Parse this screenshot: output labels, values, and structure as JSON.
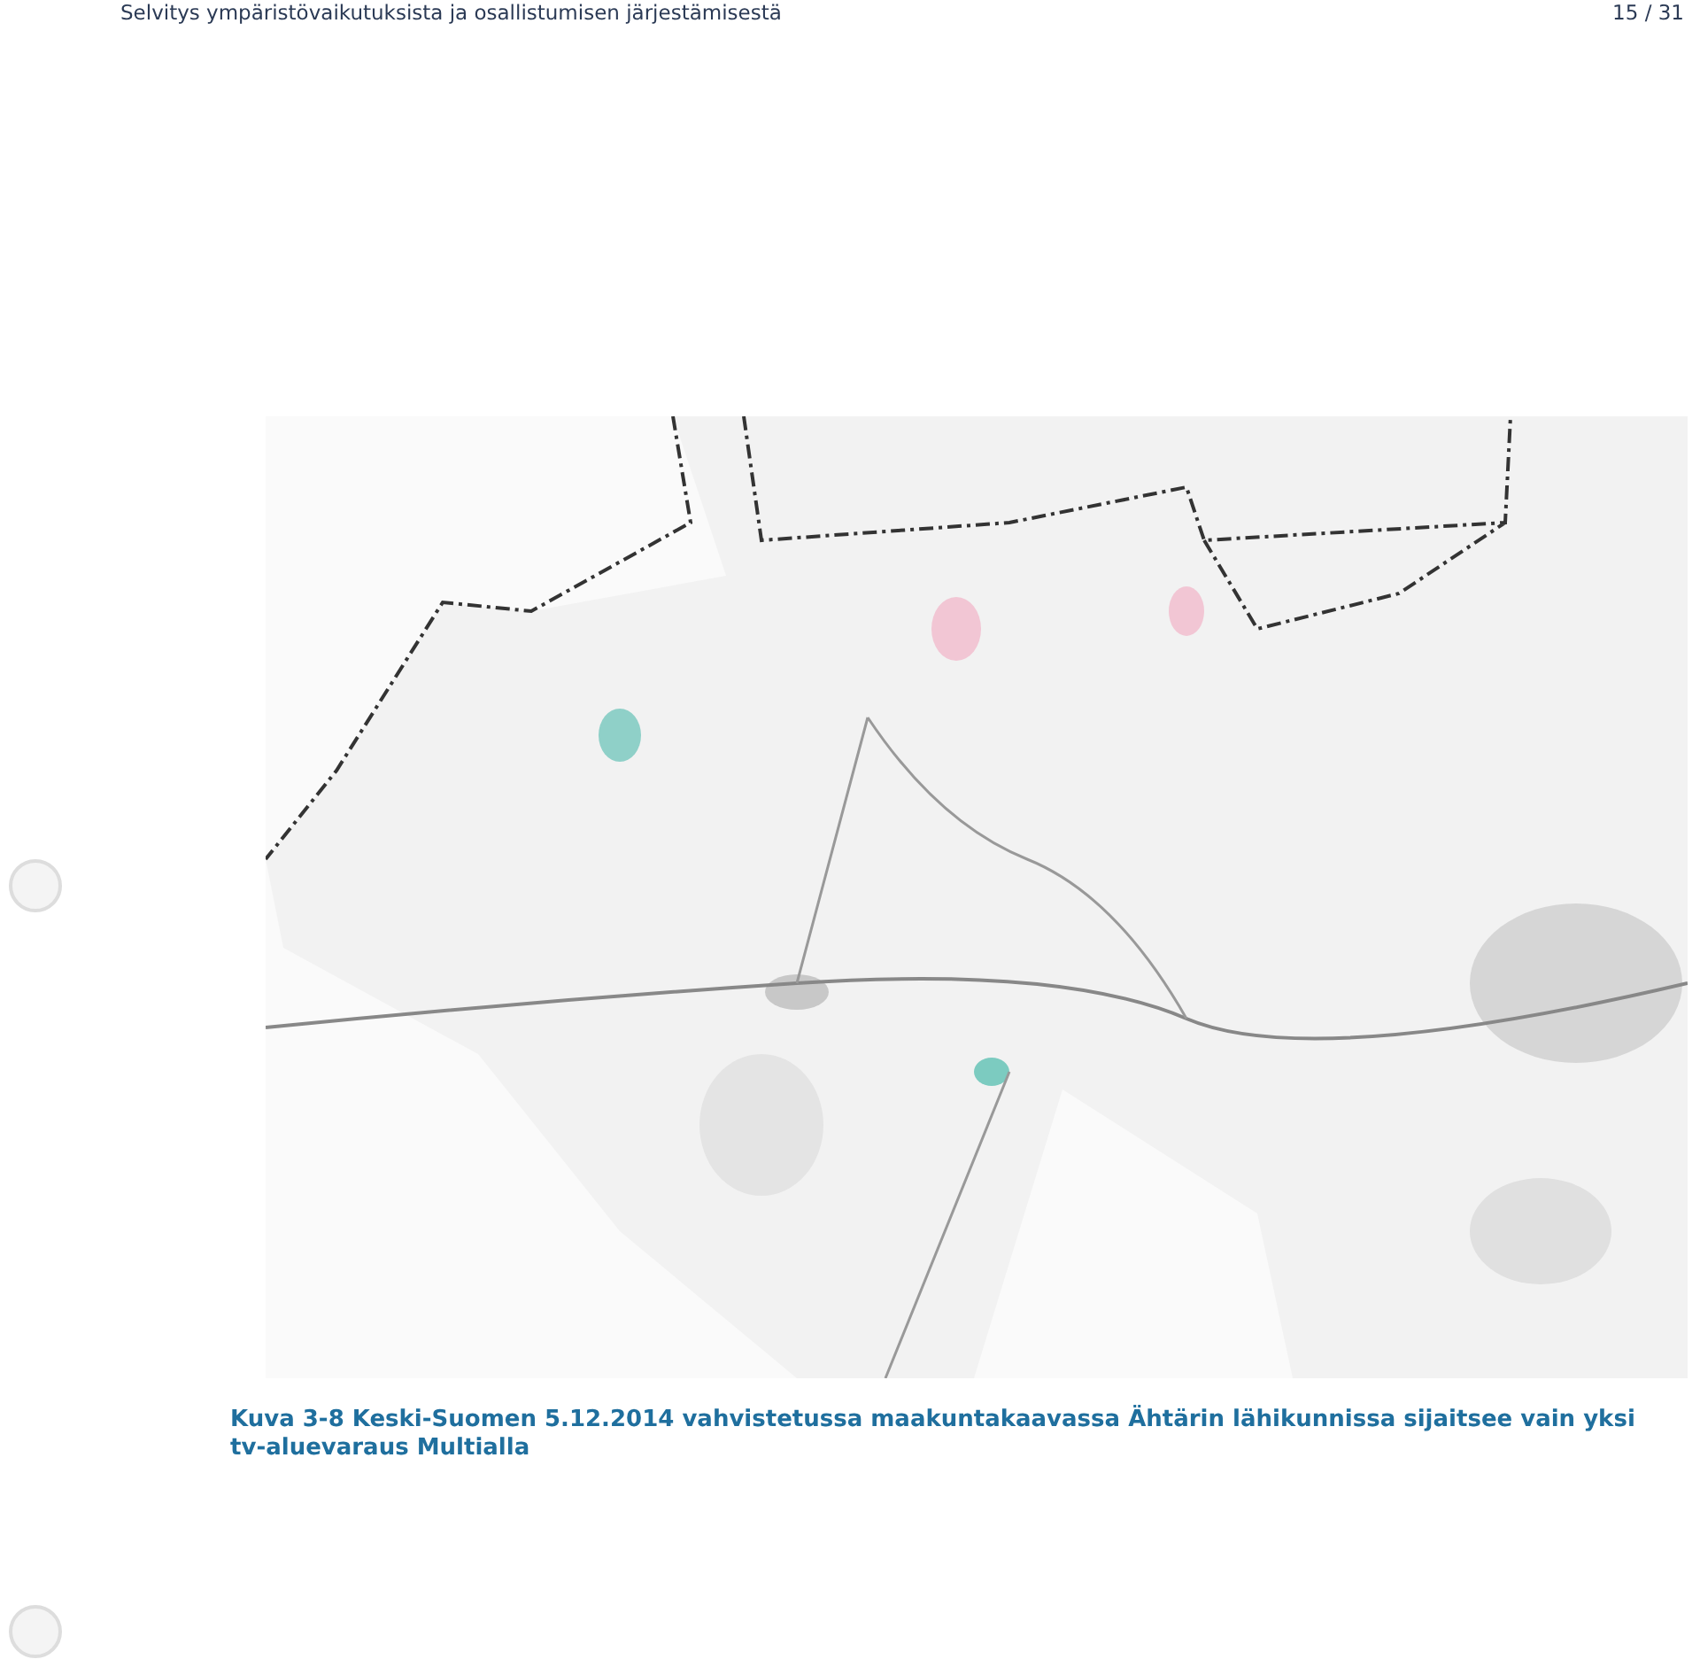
{
  "header": {
    "title": "Selvitys ympäristövaikutuksista ja osallistumisen järjestämisestä",
    "page": "15 / 31"
  },
  "figure": {
    "kind": "picture",
    "caption": "Kuva 3-8 Keski-Suomen 5.12.2014 vahvistetussa maakuntakaavassa Ähtärin lähikunnissa sijaitsee vain yksi tv-aluevaraus Multialla"
  }
}
